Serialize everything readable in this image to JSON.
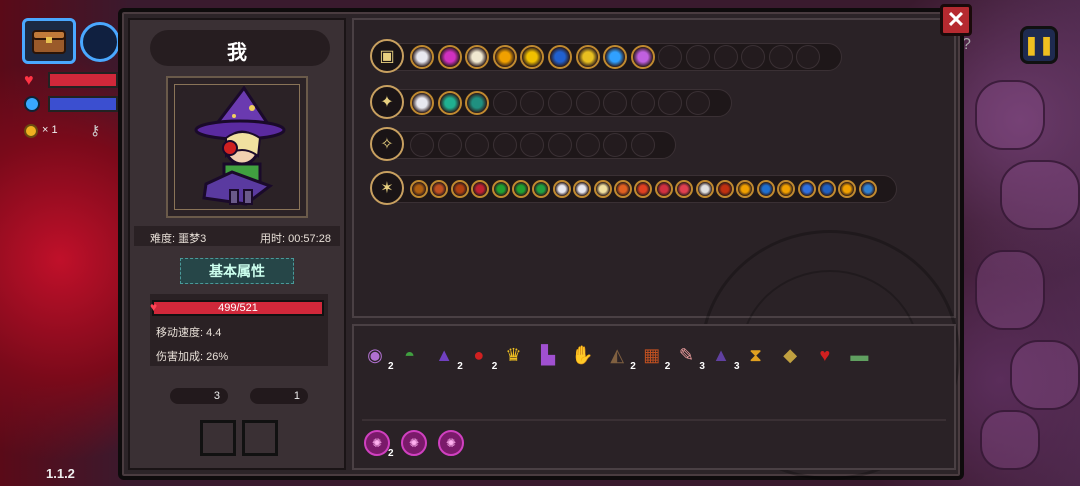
{
  "hud": {
    "coin_count": "× 1",
    "version": "1.1.2",
    "icons": [
      "chest-icon",
      "staff-icon",
      "heart-icon",
      "mana-orb-icon",
      "coin-icon",
      "key-icon",
      "pause-icon"
    ]
  },
  "close_label": "✕",
  "player": {
    "name": "我",
    "difficulty": "难度: 噩梦3",
    "time": "用时: 00:57:28",
    "attr_tab": "基本属性",
    "hp": "499/521",
    "move_speed": "移动速度: 4.4",
    "damage_bonus": "伤害加成: 26%",
    "keys": "3",
    "coins": "1"
  },
  "weapon_rows": [
    {
      "weapon": "chest",
      "filled": 9,
      "slots": 15,
      "colors": [
        "#e8e8f0",
        "#d030c0",
        "#f0e8d0",
        "#f0a000",
        "#f0c000",
        "#2060d0",
        "#e8c020",
        "#30a0ff",
        "#c060e0"
      ]
    },
    {
      "weapon": "staff",
      "filled": 3,
      "slots": 11,
      "colors": [
        "#e8e8f0",
        "#20b090",
        "#209080"
      ]
    },
    {
      "weapon": "claw",
      "filled": 0,
      "slots": 9,
      "colors": []
    },
    {
      "weapon": "scepter",
      "filled": 19,
      "slots": 19,
      "colors": [
        "#b06010",
        "#c05020",
        "#b04010",
        "#c02030",
        "#20a030",
        "#20a030",
        "#20a040",
        "#e8e8f0",
        "#e8e8f0",
        "#f0e0a0",
        "#e06020",
        "#e04020",
        "#d03040",
        "#e04050",
        "#e0e0e0",
        "#c03010",
        "#f0a000",
        "#2070d0",
        "#f0a000",
        "#3070e0",
        "#2060c0",
        "#f0a000",
        "#3080d0"
      ]
    }
  ],
  "items": [
    {
      "icon": "hood-icon",
      "count": "2",
      "color": "#b070d0"
    },
    {
      "icon": "helmet-icon",
      "count": "",
      "color": "#40a040"
    },
    {
      "icon": "wizard-hat-icon",
      "count": "2",
      "color": "#7040c0"
    },
    {
      "icon": "red-eye-icon",
      "count": "2",
      "color": "#d02020"
    },
    {
      "icon": "crown-icon",
      "count": "",
      "color": "#f0c020"
    },
    {
      "icon": "boot-icon",
      "count": "",
      "color": "#a050d0"
    },
    {
      "icon": "claw-glove-icon",
      "count": "",
      "color": "#30b040"
    },
    {
      "icon": "cloak-icon",
      "count": "2",
      "color": "#806040"
    },
    {
      "icon": "crate-icon",
      "count": "2",
      "color": "#c05020"
    },
    {
      "icon": "feather-icon",
      "count": "3",
      "color": "#f0a0a0"
    },
    {
      "icon": "robe-icon",
      "count": "3",
      "color": "#6040a0"
    },
    {
      "icon": "hourglass-icon",
      "count": "",
      "color": "#e0a020"
    },
    {
      "icon": "emerald-amulet-icon",
      "count": "",
      "color": "#c0a040"
    },
    {
      "icon": "red-bird-icon",
      "count": "",
      "color": "#d02020"
    },
    {
      "icon": "belt-icon",
      "count": "",
      "color": "#60a060"
    }
  ],
  "runes": [
    {
      "icon": "rune-icon",
      "count": "2"
    },
    {
      "icon": "rune-icon",
      "count": ""
    },
    {
      "icon": "rune-icon",
      "count": ""
    }
  ]
}
